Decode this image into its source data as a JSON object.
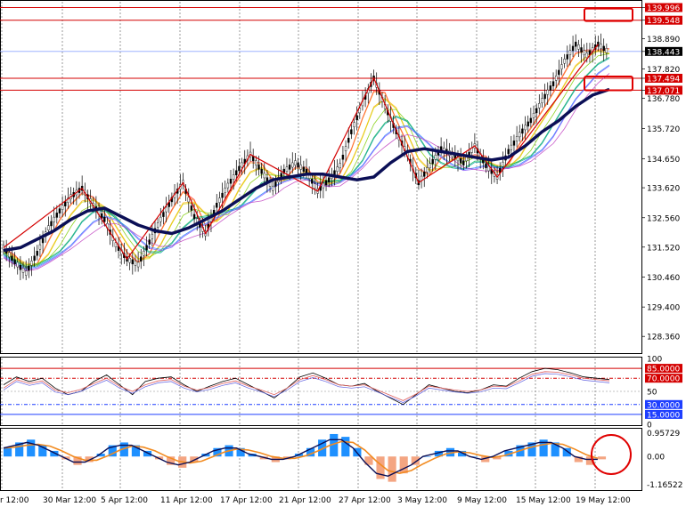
{
  "chart_data": [
    {
      "type": "line",
      "panel": "price",
      "instrument_note": "",
      "ylim": [
        127.8,
        140.2
      ],
      "y_ticks": [
        "139.996",
        "139.548",
        "138.890",
        "138.443",
        "137.820",
        "137.494",
        "137.071",
        "136.780",
        "135.720",
        "134.650",
        "133.620",
        "132.560",
        "131.520",
        "130.460",
        "129.400",
        "128.360"
      ],
      "current_price": "138.443",
      "horizontal_levels": [
        {
          "label": "139.996",
          "value": 139.996,
          "color": "#d40000"
        },
        {
          "label": "139.548",
          "value": 139.548,
          "color": "#d40000"
        },
        {
          "label": "137.494",
          "value": 137.494,
          "color": "#d40000"
        },
        {
          "label": "137.071",
          "value": 137.071,
          "color": "#d40000"
        }
      ],
      "price_path_points": [
        131.5,
        131.0,
        130.6,
        131.3,
        132.2,
        132.8,
        133.3,
        133.6,
        133.0,
        132.5,
        131.6,
        131.1,
        130.9,
        131.7,
        132.5,
        133.2,
        133.8,
        132.6,
        132.0,
        133.0,
        133.7,
        134.3,
        134.8,
        134.2,
        133.6,
        134.2,
        134.5,
        134.2,
        133.5,
        133.9,
        134.4,
        135.6,
        136.6,
        137.5,
        136.5,
        135.6,
        134.8,
        133.8,
        134.4,
        135.0,
        134.8,
        134.5,
        135.1,
        134.4,
        134.0,
        134.9,
        135.5,
        136.0,
        136.7,
        137.3,
        138.1,
        138.7,
        138.3,
        138.7,
        138.4
      ],
      "ma_thick": [
        131.4,
        131.5,
        131.8,
        132.1,
        132.5,
        132.8,
        132.9,
        132.6,
        132.3,
        132.1,
        132.0,
        132.2,
        132.5,
        132.8,
        133.2,
        133.6,
        133.9,
        134.0,
        134.1,
        134.1,
        134.0,
        133.9,
        134.0,
        134.5,
        134.9,
        135.0,
        134.9,
        134.8,
        134.7,
        134.6,
        134.7,
        135.1,
        135.6,
        136.0,
        136.5,
        136.9,
        137.1
      ],
      "levels_markers": [
        {
          "label": "box-upper",
          "value": 139.77
        },
        {
          "label": "box-lower",
          "value": 137.28
        }
      ]
    },
    {
      "type": "line",
      "panel": "oscillator",
      "ylim": [
        0,
        100
      ],
      "y_ticks": [
        "100",
        "85.0000",
        "70.0000",
        "50",
        "30.0000",
        "15.0000",
        "0"
      ],
      "levels": [
        85,
        70,
        30,
        15
      ],
      "series": [
        {
          "values": [
            60,
            72,
            65,
            70,
            55,
            45,
            50,
            65,
            75,
            60,
            45,
            65,
            70,
            72,
            60,
            50,
            58,
            65,
            70,
            60,
            50,
            40,
            55,
            72,
            78,
            70,
            60,
            58,
            62,
            50,
            40,
            30,
            45,
            60,
            55,
            50,
            48,
            52,
            60,
            58,
            70,
            80,
            85,
            83,
            78,
            72,
            70,
            68
          ]
        },
        {
          "values": [
            55,
            68,
            62,
            66,
            52,
            48,
            53,
            62,
            70,
            58,
            50,
            60,
            66,
            68,
            58,
            52,
            56,
            62,
            66,
            58,
            52,
            45,
            55,
            68,
            74,
            68,
            60,
            58,
            60,
            52,
            44,
            36,
            46,
            58,
            55,
            52,
            50,
            52,
            58,
            57,
            66,
            76,
            80,
            79,
            75,
            70,
            68,
            66
          ]
        }
      ]
    },
    {
      "type": "bar",
      "panel": "macd",
      "ylim": [
        -1.16522,
        0.95729
      ],
      "y_ticks": [
        "0.95729",
        "0.00",
        "-1.16522"
      ],
      "histogram": [
        0.3,
        0.5,
        0.6,
        0.4,
        0.2,
        -0.1,
        -0.3,
        -0.2,
        0.1,
        0.4,
        0.5,
        0.4,
        0.2,
        -0.1,
        -0.3,
        -0.4,
        -0.2,
        0.1,
        0.3,
        0.4,
        0.3,
        0.1,
        -0.1,
        -0.2,
        -0.1,
        0.1,
        0.3,
        0.6,
        0.8,
        0.7,
        0.3,
        -0.3,
        -0.8,
        -0.9,
        -0.6,
        -0.3,
        0.0,
        0.2,
        0.3,
        0.2,
        0.0,
        -0.2,
        -0.1,
        0.2,
        0.4,
        0.5,
        0.6,
        0.5,
        0.3,
        -0.2,
        -0.3,
        -0.1
      ],
      "signal": [
        0.3,
        0.4,
        0.5,
        0.4,
        0.2,
        0.0,
        -0.2,
        -0.2,
        0.0,
        0.3,
        0.4,
        0.4,
        0.2,
        0.0,
        -0.2,
        -0.3,
        -0.2,
        0.0,
        0.2,
        0.3,
        0.3,
        0.1,
        0.0,
        -0.1,
        -0.1,
        0.0,
        0.2,
        0.4,
        0.6,
        0.6,
        0.3,
        -0.2,
        -0.6,
        -0.7,
        -0.5,
        -0.3,
        0.0,
        0.1,
        0.2,
        0.2,
        0.0,
        -0.1,
        0.0,
        0.2,
        0.3,
        0.4,
        0.5,
        0.5,
        0.3,
        0.0,
        -0.1,
        -0.1
      ]
    }
  ],
  "x_axis": {
    "labels": [
      "r 12:00",
      "30 Mar 12:00",
      "5 Apr 12:00",
      "11 Apr 12:00",
      "17 Apr 12:00",
      "21 Apr 12:00",
      "27 Apr 12:00",
      "3 May 12:00",
      "9 May 12:00",
      "15 May 12:00",
      "19 May 12:00"
    ]
  },
  "colors": {
    "accent_red": "#d40000",
    "ma_thick": "#0b0f56",
    "bar_up": "#1e90ff",
    "bar_down": "#f4a582",
    "signal": "#0b0f56",
    "signal2": "#f28b20",
    "blue_level": "#1f3fff",
    "osc_black": "#000000",
    "osc_red": "#e06060",
    "osc_blue": "#6060e0"
  },
  "icons": {
    "annotation-circle": "circle-outline",
    "annotation-boxes": "rect-outline"
  }
}
